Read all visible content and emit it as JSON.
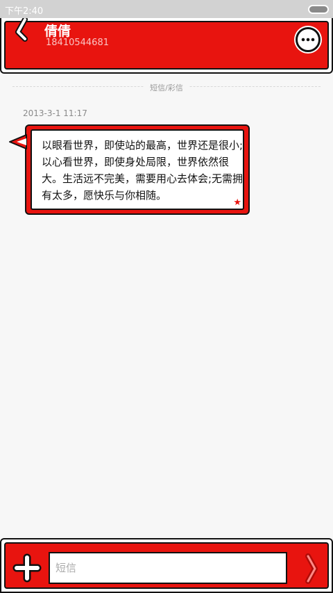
{
  "status_bar": {
    "time": "下午2:40"
  },
  "header": {
    "contact_name": "倩倩",
    "phone_number": "18410544681"
  },
  "separator": {
    "label": "短信/彩信"
  },
  "message": {
    "timestamp": "2013-3-1 11:17",
    "text": "以眼看世界，即使站的最高，世界还是很小;以心看世界，即使身处局限，世界依然很大。生活远不完美，需要用心去体会;无需拥有太多，愿快乐与你相随。",
    "starred": true
  },
  "composer": {
    "placeholder": "短信"
  },
  "colors": {
    "accent": "#e8140f",
    "outline": "#111111",
    "background": "#f7f7f7"
  },
  "icons": {
    "back": "back-arrow-icon",
    "more": "more-dots-icon",
    "add": "plus-icon",
    "send": "send-arrow-icon",
    "star": "star-icon"
  }
}
